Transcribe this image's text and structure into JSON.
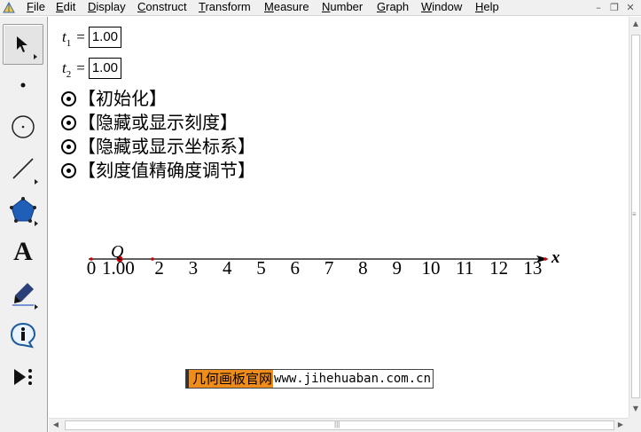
{
  "menu": [
    "File",
    "Edit",
    "Display",
    "Construct",
    "Transform",
    "Measure",
    "Number",
    "Graph",
    "Window",
    "Help"
  ],
  "menu_mnemonics": [
    "F",
    "E",
    "D",
    "C",
    "T",
    "M",
    "N",
    "G",
    "W",
    "H"
  ],
  "window_controls": {
    "minimize": "–",
    "restore": "❐",
    "close": "✕"
  },
  "tools": [
    "arrow-select",
    "point",
    "compass",
    "straightedge",
    "polygon",
    "text",
    "marker",
    "information",
    "custom"
  ],
  "text_tool_glyph": "A",
  "params": [
    {
      "name": "t",
      "sub": "1",
      "eq": "=",
      "value": "1.00"
    },
    {
      "name": "t",
      "sub": "2",
      "eq": "=",
      "value": "1.00"
    }
  ],
  "actions": [
    "【初始化】",
    "【隐藏或显示刻度】",
    "【隐藏或显示坐标系】",
    "【刻度值精确度调节】"
  ],
  "axis": {
    "ticks": [
      "0",
      "2",
      "3",
      "4",
      "5",
      "6",
      "7",
      "8",
      "9",
      "10",
      "11",
      "12",
      "13"
    ],
    "point_label": "Q",
    "point_value": "1.00",
    "axis_label": "x",
    "line_color": "#000000",
    "point_color": "#cc0000"
  },
  "footer": {
    "cn": "几何画板官网",
    "url": "www.jihehuaban.com.cn"
  },
  "accent_color": "#f08c1a"
}
